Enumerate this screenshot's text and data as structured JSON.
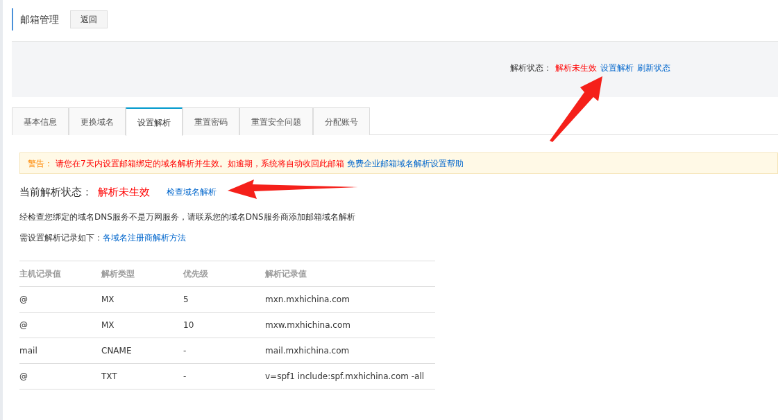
{
  "header": {
    "title": "邮箱管理",
    "back_button": "返回"
  },
  "status_panel": {
    "label": "解析状态：",
    "status": "解析未生效",
    "links": [
      "设置解析",
      "刷新状态"
    ]
  },
  "tabs": [
    {
      "label": "基本信息",
      "selected": false
    },
    {
      "label": "更换域名",
      "selected": false
    },
    {
      "label": "设置解析",
      "selected": true
    },
    {
      "label": "重置密码",
      "selected": false
    },
    {
      "label": "重置安全问题",
      "selected": false
    },
    {
      "label": "分配账号",
      "selected": false
    }
  ],
  "warning": {
    "label": "警告：",
    "message": "请您在7天内设置邮箱绑定的域名解析并生效。如逾期，系统将自动收回此邮箱",
    "link": "免费企业邮箱域名解析设置帮助"
  },
  "current_status": {
    "label": "当前解析状态：",
    "status": "解析未生效",
    "link": "检查域名解析"
  },
  "notice": "经检查您绑定的域名DNS服务不是万网服务，请联系您的域名DNS服务商添加邮箱域名解析",
  "records_intro": {
    "text": "需设置解析记录如下：",
    "link": "各域名注册商解析方法"
  },
  "table": {
    "columns": [
      "主机记录值",
      "解析类型",
      "优先级",
      "解析记录值"
    ],
    "rows": [
      [
        "@",
        "MX",
        "5",
        "mxn.mxhichina.com"
      ],
      [
        "@",
        "MX",
        "10",
        "mxw.mxhichina.com"
      ],
      [
        "mail",
        "CNAME",
        "-",
        "mail.mxhichina.com"
      ],
      [
        "@",
        "TXT",
        "-",
        "v=spf1 include:spf.mxhichina.com -all"
      ]
    ]
  }
}
